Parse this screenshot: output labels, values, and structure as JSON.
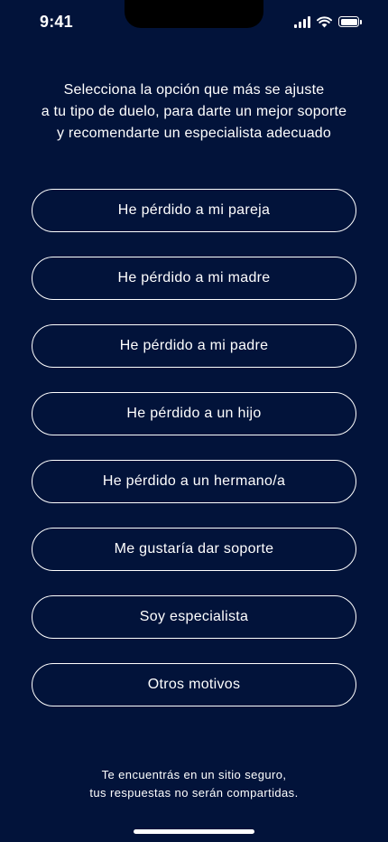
{
  "status_bar": {
    "time": "9:41",
    "icons": [
      "cellular-signal-icon",
      "wifi-icon",
      "battery-icon"
    ]
  },
  "intro": {
    "line1": "Selecciona la opción que más se ajuste",
    "line2": "a tu tipo de duelo, para darte un mejor soporte",
    "line3": "y recomendarte un especialista adecuado"
  },
  "options": [
    {
      "label": "He pérdido a mi pareja"
    },
    {
      "label": "He pérdido a mi madre"
    },
    {
      "label": "He pérdido a mi padre"
    },
    {
      "label": "He pérdido a un hijo"
    },
    {
      "label": "He pérdido a un hermano/a"
    },
    {
      "label": "Me gustaría dar soporte"
    },
    {
      "label": "Soy especialista"
    },
    {
      "label": "Otros motivos"
    }
  ],
  "footer": {
    "line1": "Te encuentrás en un sitio seguro,",
    "line2": "tus respuestas no serán compartidas."
  },
  "colors": {
    "background": "#02133a",
    "text": "#ffffff",
    "button_border": "#ffffff"
  }
}
